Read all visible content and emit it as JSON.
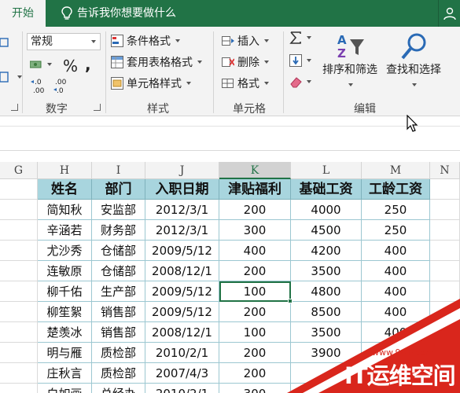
{
  "tabs": {
    "home": "开始",
    "tell_me": "告诉我你想要做什么"
  },
  "ribbon": {
    "number": {
      "format_value": "常规",
      "percent": "%",
      "comma": ",",
      "inc_dec": "←.0\n.00",
      "dec_dec": ".00\n→.0",
      "group_label": "数字"
    },
    "styles": {
      "conditional": "条件格式",
      "table_format": "套用表格格式",
      "cell_styles": "单元格样式",
      "group_label": "样式"
    },
    "cells": {
      "insert": "插入",
      "delete": "删除",
      "format": "格式",
      "group_label": "单元格"
    },
    "editing": {
      "sort_filter": "排序和筛选",
      "find_select": "查找和选择",
      "group_label": "编辑"
    }
  },
  "columns": [
    "G",
    "H",
    "I",
    "J",
    "K",
    "L",
    "M",
    "N"
  ],
  "selected_column": "K",
  "table": {
    "headers": [
      "姓名",
      "部门",
      "入职日期",
      "津贴福利",
      "基础工资",
      "工龄工资"
    ],
    "rows": [
      [
        "简知秋",
        "安监部",
        "2012/3/1",
        "200",
        "4000",
        "250"
      ],
      [
        "辛涵若",
        "财务部",
        "2012/3/1",
        "300",
        "4500",
        "250"
      ],
      [
        "尤沙秀",
        "仓储部",
        "2009/5/12",
        "400",
        "4200",
        "400"
      ],
      [
        "连敏原",
        "仓储部",
        "2008/12/1",
        "200",
        "3500",
        "400"
      ],
      [
        "柳千佑",
        "生产部",
        "2009/5/12",
        "100",
        "4800",
        "400"
      ],
      [
        "柳笙絮",
        "销售部",
        "2009/5/12",
        "200",
        "8500",
        "400"
      ],
      [
        "楚羡冰",
        "销售部",
        "2008/12/1",
        "100",
        "3500",
        "400"
      ],
      [
        "明与雁",
        "质检部",
        "2010/2/1",
        "200",
        "3900",
        ""
      ],
      [
        "庄秋言",
        "质检部",
        "2007/4/3",
        "200",
        "",
        ""
      ],
      [
        "白如画",
        "总经办",
        "2010/2/1",
        "300",
        "",
        ""
      ]
    ]
  },
  "watermark": {
    "url": "www.94IP.com",
    "brand": "IT运维空间"
  },
  "colors": {
    "accent": "#217346",
    "header_fill": "#a8d5de",
    "watermark_red": "#d9261c"
  }
}
